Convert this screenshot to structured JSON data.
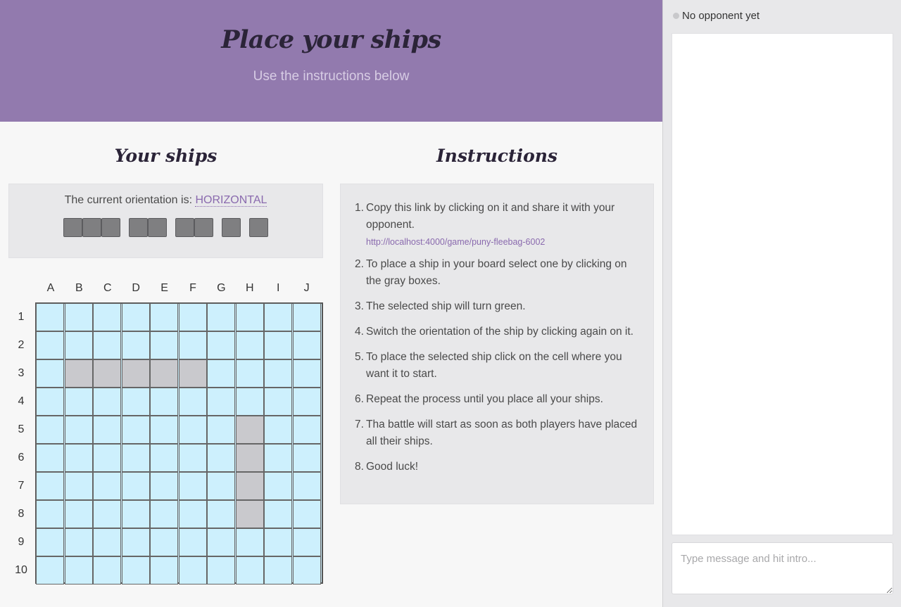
{
  "header": {
    "title": "Place your ships",
    "subtitle": "Use the instructions below"
  },
  "ships_panel": {
    "title": "Your ships",
    "orientation_label": "The current orientation is:",
    "orientation_value": "HORIZONTAL",
    "fleet": [
      {
        "name": "ship-3",
        "length": 3
      },
      {
        "name": "ship-2",
        "length": 2
      },
      {
        "name": "ship-2b",
        "length": 2
      },
      {
        "name": "ship-1",
        "length": 1
      },
      {
        "name": "ship-1b",
        "length": 1
      }
    ]
  },
  "board": {
    "columns": [
      "A",
      "B",
      "C",
      "D",
      "E",
      "F",
      "G",
      "H",
      "I",
      "J"
    ],
    "rows": [
      "1",
      "2",
      "3",
      "4",
      "5",
      "6",
      "7",
      "8",
      "9",
      "10"
    ],
    "occupied_cells": [
      "B3",
      "C3",
      "D3",
      "E3",
      "F3",
      "H5",
      "H6",
      "H7",
      "H8"
    ]
  },
  "instructions": {
    "title": "Instructions",
    "items": [
      {
        "num": "1.",
        "text": "Copy this link by clicking on it and share it with your opponent.",
        "link": "http://localhost:4000/game/puny-fleebag-6002"
      },
      {
        "num": "2.",
        "text": "To place a ship in your board select one by clicking on the gray boxes."
      },
      {
        "num": "3.",
        "text": "The selected ship will turn green."
      },
      {
        "num": "4.",
        "text": "Switch the orientation of the ship by clicking again on it."
      },
      {
        "num": "5.",
        "text": "To place the selected ship click on the cell where you want it to start."
      },
      {
        "num": "6.",
        "text": "Repeat the process until you place all your ships."
      },
      {
        "num": "7.",
        "text": "Tha battle will start as soon as both players have placed all their ships."
      },
      {
        "num": "8.",
        "text": "Good luck!"
      }
    ]
  },
  "sidebar": {
    "status": "No opponent yet",
    "chat_placeholder": "Type message and hit intro..."
  },
  "colors": {
    "header_bg": "#927aae",
    "accent": "#8a6aae",
    "water_cell": "#cdf0fd",
    "ship_cell": "#c9c9cd",
    "fleet_ship": "#7f7f81"
  }
}
